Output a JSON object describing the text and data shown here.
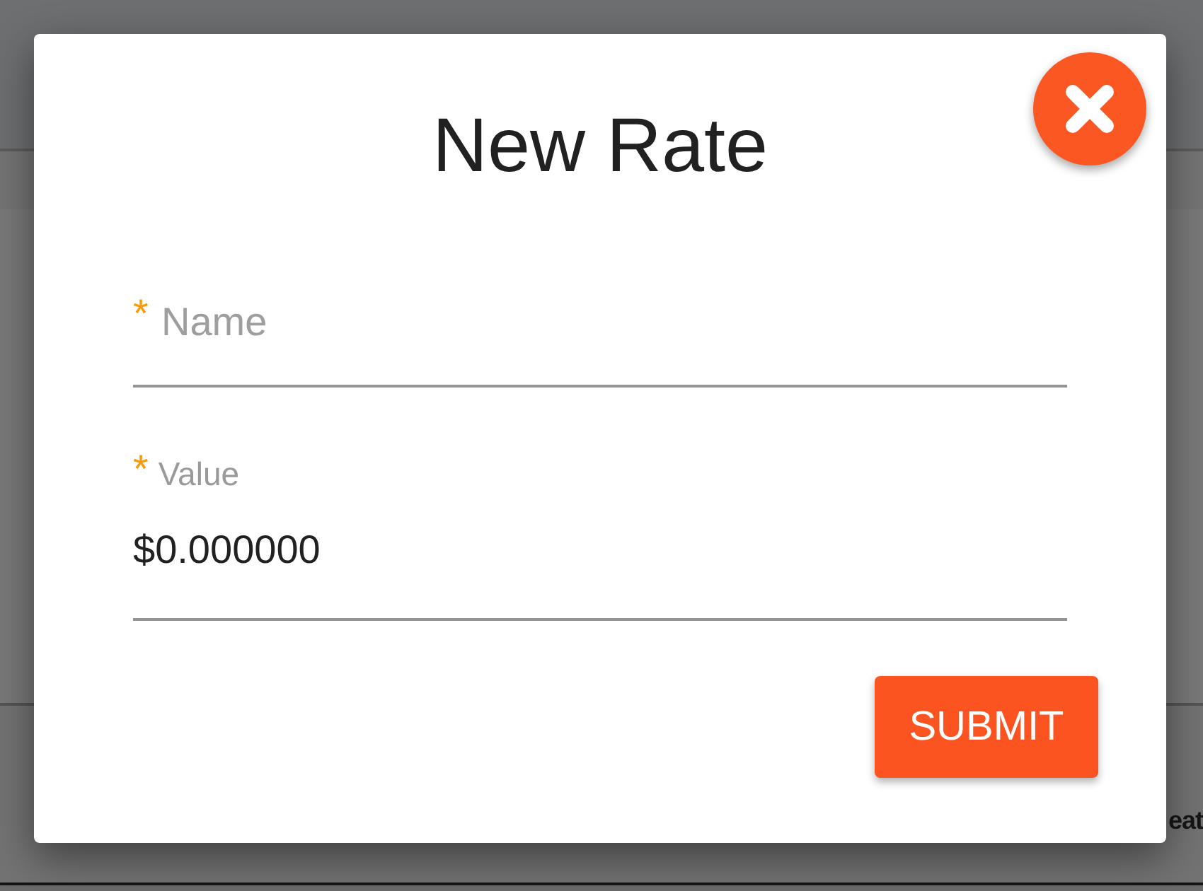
{
  "background": {
    "heading_fragment": "eat"
  },
  "dialog": {
    "title": "New Rate",
    "fields": [
      {
        "required_mark": "*",
        "placeholder": "Name"
      },
      {
        "required_mark": "*",
        "label": "Value",
        "value": "$0.000000"
      }
    ],
    "submit_button": "SUBMIT"
  }
}
